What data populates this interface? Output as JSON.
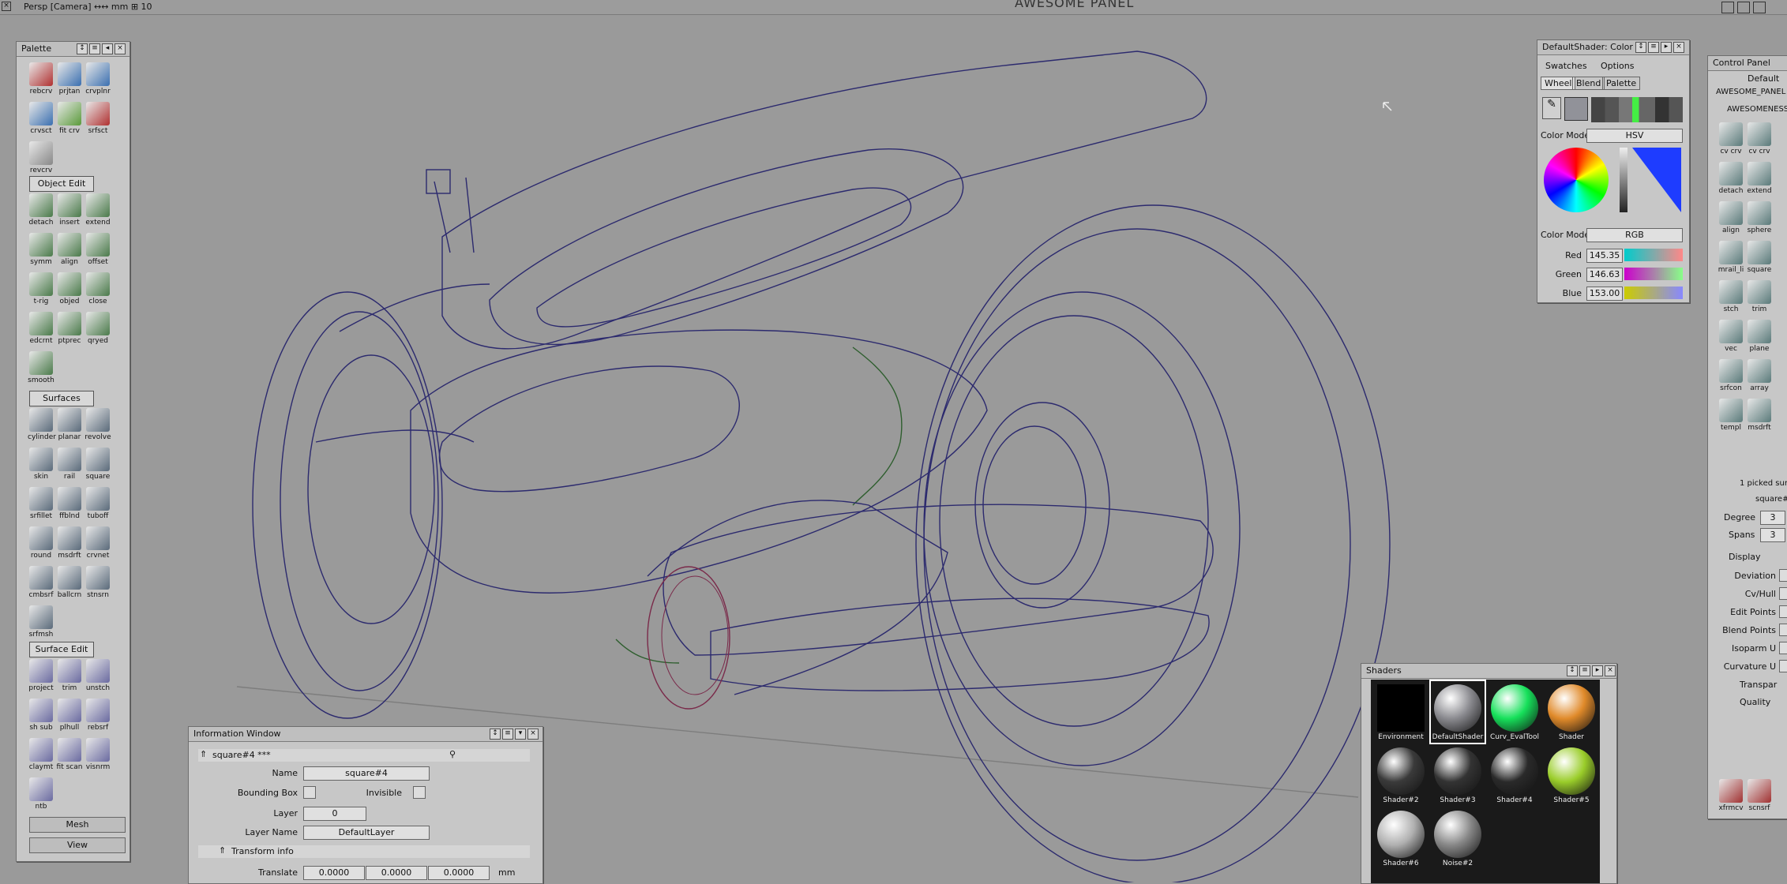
{
  "topbar": {
    "camera": "Persp [Camera] ↔↔ mm  ⊞ 10",
    "title": "AWESOME PANEL"
  },
  "palette": {
    "title": "Palette",
    "curves_tools": [
      {
        "label": "rebcrv",
        "color": "#b03030"
      },
      {
        "label": "prjtan",
        "color": "#3a6fb0"
      },
      {
        "label": "crvplnr",
        "color": "#3a6fb0"
      },
      {
        "label": "crvsct",
        "color": "#3a6fb0"
      },
      {
        "label": "fit crv",
        "color": "#5a9a3a"
      },
      {
        "label": "srfsct",
        "color": "#b03030"
      },
      {
        "label": "revcrv",
        "color": "#888888"
      }
    ],
    "sections": {
      "object_edit": "Object Edit",
      "surfaces": "Surfaces",
      "surface_edit": "Surface Edit"
    },
    "object_edit_tools": [
      "detach",
      "insert",
      "extend",
      "symm",
      "align",
      "offset",
      "t-rig",
      "objed",
      "close",
      "edcrnt",
      "ptprec",
      "qryed",
      "smooth"
    ],
    "surfaces_tools": [
      "cylinder",
      "planar",
      "revolve",
      "skin",
      "rail",
      "square",
      "srfillet",
      "ffblnd",
      "tuboff",
      "round",
      "msdrft",
      "crvnet",
      "cmbsrf",
      "ballcrn",
      "stnsrn",
      "srfmsh"
    ],
    "surface_edit_tools": [
      "project",
      "trim",
      "unstch",
      "sh sub",
      "plhull",
      "rebsrf",
      "claymt",
      "fit scan",
      "visnrm",
      "ntb"
    ],
    "mesh_label": "Mesh",
    "view_label": "View"
  },
  "info": {
    "title": "Information Window",
    "object": "square#4 ***",
    "name_label": "Name",
    "name_value": "square#4",
    "bbox_label": "Bounding Box",
    "invisible_label": "Invisible",
    "layer_label": "Layer",
    "layer_value": "0",
    "layer_name_label": "Layer Name",
    "layer_name_value": "DefaultLayer",
    "transform_label": "Transform info",
    "translate_label": "Translate",
    "translate": [
      "0.0000",
      "0.0000",
      "0.0000"
    ],
    "unit": "mm"
  },
  "color": {
    "title": "DefaultShader: Color",
    "menu": [
      "Swatches",
      "Options"
    ],
    "tabs": [
      "Wheel",
      "Blend",
      "Palette"
    ],
    "model_label": "Color Model",
    "model_hsv": "HSV",
    "model_rgb": "RGB",
    "red_label": "Red",
    "red_value": "145.35",
    "green_label": "Green",
    "green_value": "146.63",
    "blue_label": "Blue",
    "blue_value": "153.00",
    "current_color": "#919299"
  },
  "shaders": {
    "title": "Shaders",
    "items": [
      {
        "label": "Environment",
        "color": "#000000"
      },
      {
        "label": "DefaultShader",
        "color": "#8a8a8f"
      },
      {
        "label": "Curv_EvalTool",
        "color": "#16e05a"
      },
      {
        "label": "Shader",
        "color": "#e08a2a"
      },
      {
        "label": "Shader#2",
        "color": "#3a3a3a"
      },
      {
        "label": "Shader#3",
        "color": "#333333"
      },
      {
        "label": "Shader#4",
        "color": "#2a2a2a"
      },
      {
        "label": "Shader#5",
        "color": "#9acd2a"
      },
      {
        "label": "Shader#6",
        "color": "#b0b0b0"
      },
      {
        "label": "Noise#2",
        "color": "#888888"
      }
    ]
  },
  "control": {
    "title": "Control Panel",
    "preset": "Default",
    "panel_name": "AWESOME_PANEL",
    "shelf_name": "AWESOMENESS",
    "tools": [
      "cv crv",
      "cv crv",
      "detach",
      "extend",
      "align",
      "sphere",
      "mrail_li",
      "square",
      "stch",
      "trim",
      "vec",
      "plane",
      "srfcon",
      "array",
      "templ",
      "msdrft"
    ],
    "picked": "1 picked sur",
    "object": "square#",
    "degree_label": "Degree",
    "degree_value": "3",
    "spans_label": "Spans",
    "spans_value": "3",
    "display_label": "Display",
    "display_items": [
      "Deviation",
      "Cv/Hull",
      "Edit Points",
      "Blend Points",
      "Isoparm U",
      "Curvature U"
    ],
    "transparency_label": "Transpar",
    "quality_label": "Quality",
    "bottom_tools": [
      "xfrmcv",
      "scnsrf"
    ]
  }
}
